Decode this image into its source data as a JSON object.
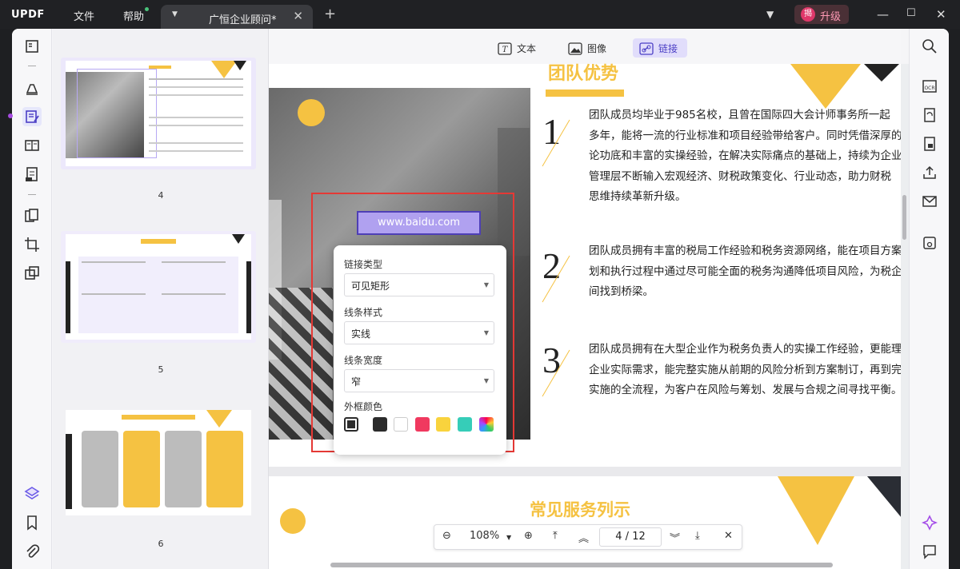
{
  "app": {
    "logo": "UPDF",
    "menu_file": "文件",
    "menu_help": "帮助",
    "tab_title": "广恒企业顾问*",
    "upgrade_label": "升级",
    "upgrade_avatar": "揭"
  },
  "tooltabs": [
    {
      "label": "文本",
      "icon": "text-icon"
    },
    {
      "label": "图像",
      "icon": "image-icon"
    },
    {
      "label": "链接",
      "icon": "link-icon",
      "active": true
    }
  ],
  "thumbnails": [
    {
      "page": "4"
    },
    {
      "page": "5"
    },
    {
      "page": "6"
    }
  ],
  "page": {
    "heading1": "团队优势",
    "heading2": "常见服务列示",
    "link_label": "www.baidu.com",
    "items": [
      {
        "num": "1",
        "text": "团队成员均毕业于985名校，且曾在国际四大会计师事务所一起\n多年，能将一流的行业标准和项目经验带给客户。同时凭借深厚的\n论功底和丰富的实操经验，在解决实际痛点的基础上，持续为企业\n管理层不断输入宏观经济、财税政策变化、行业动态，助力财税\n思维持续革新升级。"
      },
      {
        "num": "2",
        "text": "团队成员拥有丰富的税局工作经验和税务资源网络，能在项目方案\n划和执行过程中通过尽可能全面的税务沟通降低项目风险，为税企\n间找到桥梁。"
      },
      {
        "num": "3",
        "text": "团队成员拥有在大型企业作为税务负责人的实操工作经验，更能理\n企业实际需求，能完整实施从前期的风险分析到方案制订，再到完\n实施的全流程，为客户在风险与筹划、发展与合规之间寻找平衡。"
      }
    ]
  },
  "link_popup": {
    "type_label": "链接类型",
    "type_value": "可见矩形",
    "style_label": "线条样式",
    "style_value": "实线",
    "width_label": "线条宽度",
    "width_value": "窄",
    "color_label": "外框颜色",
    "colors": [
      "#2b2b2b",
      "#ffffff",
      "#f0395f",
      "#f9d33d",
      "#36cdb8"
    ]
  },
  "nav": {
    "zoom": "108%",
    "current_page": "4",
    "total_pages": "12",
    "sep": "/"
  },
  "colors": {
    "accent": "#6d5ce8",
    "yellow": "#f5c242",
    "red": "#e53935"
  }
}
